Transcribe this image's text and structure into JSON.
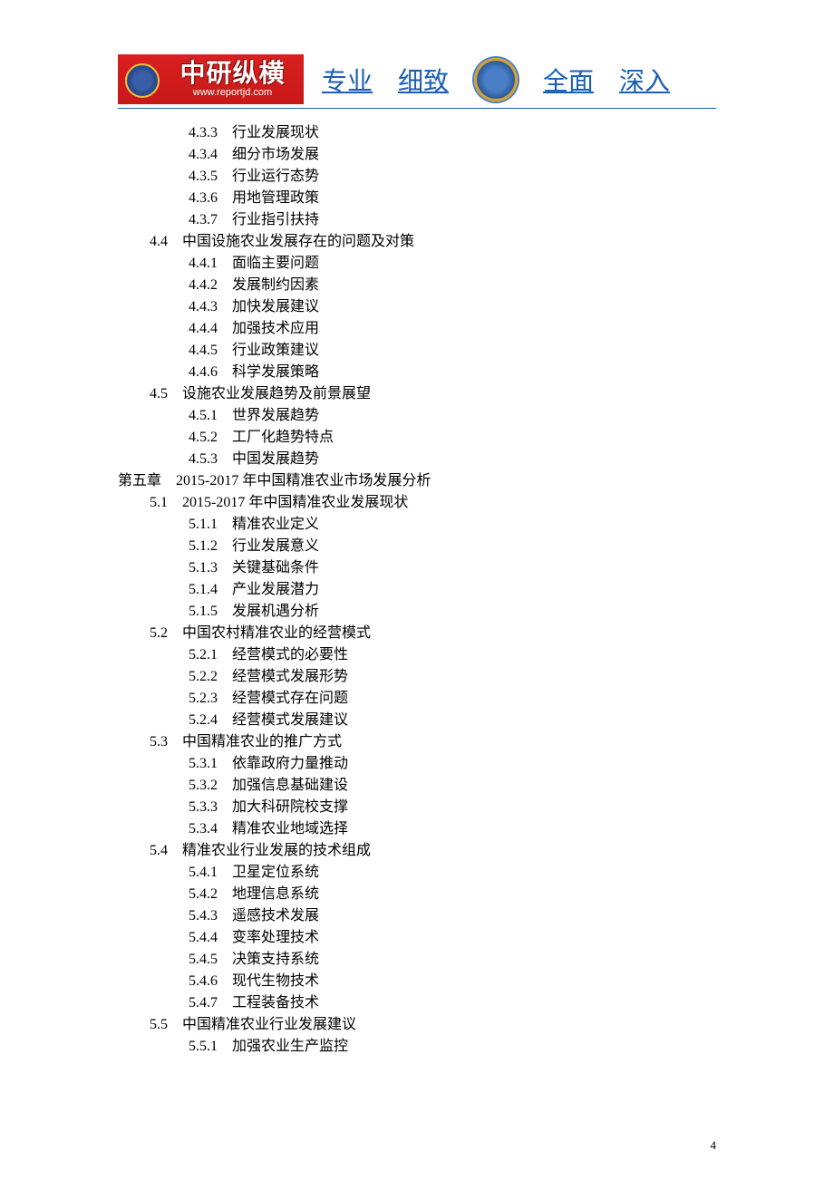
{
  "header": {
    "logo_text": "中研纵横",
    "logo_url": "www.reportjd.com",
    "slogan": [
      "专业",
      "细致",
      "全面",
      "深入"
    ]
  },
  "toc": [
    {
      "level": 3,
      "num": "4.3.3",
      "title": "行业发展现状"
    },
    {
      "level": 3,
      "num": "4.3.4",
      "title": "细分市场发展"
    },
    {
      "level": 3,
      "num": "4.3.5",
      "title": "行业运行态势"
    },
    {
      "level": 3,
      "num": "4.3.6",
      "title": "用地管理政策"
    },
    {
      "level": 3,
      "num": "4.3.7",
      "title": "行业指引扶持"
    },
    {
      "level": 2,
      "num": "4.4",
      "title": "中国设施农业发展存在的问题及对策"
    },
    {
      "level": 3,
      "num": "4.4.1",
      "title": "面临主要问题"
    },
    {
      "level": 3,
      "num": "4.4.2",
      "title": "发展制约因素"
    },
    {
      "level": 3,
      "num": "4.4.3",
      "title": "加快发展建议"
    },
    {
      "level": 3,
      "num": "4.4.4",
      "title": "加强技术应用"
    },
    {
      "level": 3,
      "num": "4.4.5",
      "title": "行业政策建议"
    },
    {
      "level": 3,
      "num": "4.4.6",
      "title": "科学发展策略"
    },
    {
      "level": 2,
      "num": "4.5",
      "title": "设施农业发展趋势及前景展望"
    },
    {
      "level": 3,
      "num": "4.5.1",
      "title": "世界发展趋势"
    },
    {
      "level": 3,
      "num": "4.5.2",
      "title": "工厂化趋势特点"
    },
    {
      "level": 3,
      "num": "4.5.3",
      "title": "中国发展趋势"
    },
    {
      "level": 1,
      "num": "第五章",
      "title": "2015-2017 年中国精准农业市场发展分析"
    },
    {
      "level": 2,
      "num": "5.1",
      "title": "2015-2017 年中国精准农业发展现状"
    },
    {
      "level": 3,
      "num": "5.1.1",
      "title": "精准农业定义"
    },
    {
      "level": 3,
      "num": "5.1.2",
      "title": "行业发展意义"
    },
    {
      "level": 3,
      "num": "5.1.3",
      "title": "关键基础条件"
    },
    {
      "level": 3,
      "num": "5.1.4",
      "title": "产业发展潜力"
    },
    {
      "level": 3,
      "num": "5.1.5",
      "title": "发展机遇分析"
    },
    {
      "level": 2,
      "num": "5.2",
      "title": "中国农村精准农业的经营模式"
    },
    {
      "level": 3,
      "num": "5.2.1",
      "title": "经营模式的必要性"
    },
    {
      "level": 3,
      "num": "5.2.2",
      "title": "经营模式发展形势"
    },
    {
      "level": 3,
      "num": "5.2.3",
      "title": "经营模式存在问题"
    },
    {
      "level": 3,
      "num": "5.2.4",
      "title": "经营模式发展建议"
    },
    {
      "level": 2,
      "num": "5.3",
      "title": "中国精准农业的推广方式"
    },
    {
      "level": 3,
      "num": "5.3.1",
      "title": "依靠政府力量推动"
    },
    {
      "level": 3,
      "num": "5.3.2",
      "title": "加强信息基础建设"
    },
    {
      "level": 3,
      "num": "5.3.3",
      "title": "加大科研院校支撑"
    },
    {
      "level": 3,
      "num": "5.3.4",
      "title": "精准农业地域选择"
    },
    {
      "level": 2,
      "num": "5.4",
      "title": "精准农业行业发展的技术组成"
    },
    {
      "level": 3,
      "num": "5.4.1",
      "title": "卫星定位系统"
    },
    {
      "level": 3,
      "num": "5.4.2",
      "title": "地理信息系统"
    },
    {
      "level": 3,
      "num": "5.4.3",
      "title": "遥感技术发展"
    },
    {
      "level": 3,
      "num": "5.4.4",
      "title": "变率处理技术"
    },
    {
      "level": 3,
      "num": "5.4.5",
      "title": "决策支持系统"
    },
    {
      "level": 3,
      "num": "5.4.6",
      "title": "现代生物技术"
    },
    {
      "level": 3,
      "num": "5.4.7",
      "title": "工程装备技术"
    },
    {
      "level": 2,
      "num": "5.5",
      "title": "中国精准农业行业发展建议"
    },
    {
      "level": 3,
      "num": "5.5.1",
      "title": "加强农业生产监控"
    }
  ],
  "page_number": "4"
}
